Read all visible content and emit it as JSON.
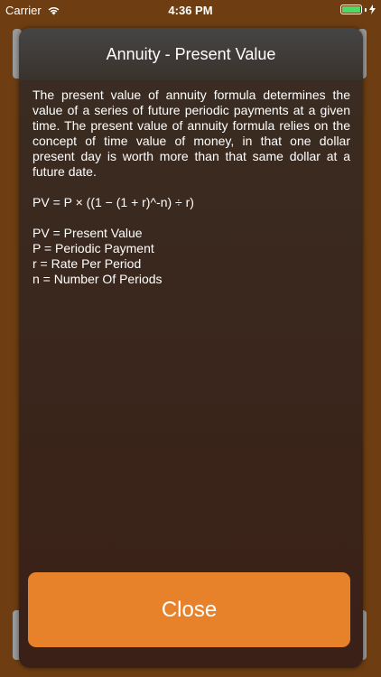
{
  "status_bar": {
    "carrier": "Carrier",
    "time": "4:36 PM"
  },
  "dialog": {
    "title": "Annuity - Present Value",
    "description": "The present value of annuity formula determines the value of a series of future periodic payments at a given time. The present value of annuity formula relies on the concept of time value of money, in that one dollar present day is worth more than that same dollar at a future date.",
    "formula": "PV = P × ((1 − (1 + r)^-n) ÷ r)",
    "legend": [
      "PV = Present Value",
      "P = Periodic Payment",
      "r = Rate Per Period",
      "n = Number Of Periods"
    ],
    "close_label": "Close"
  },
  "colors": {
    "background": "#6e3e12",
    "button": "#e7822a",
    "battery": "#4cd964"
  }
}
